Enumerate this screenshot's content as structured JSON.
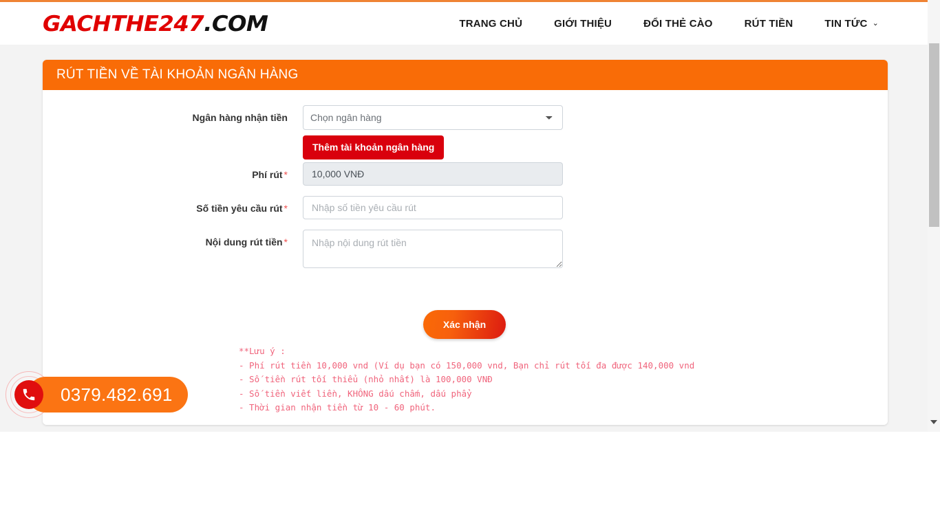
{
  "site": {
    "logo_red": "GACHTHE247",
    "logo_black": ".COM"
  },
  "nav": {
    "items": [
      {
        "label": "TRANG CHỦ",
        "has_chevron": false
      },
      {
        "label": "GIỚI THIỆU",
        "has_chevron": false
      },
      {
        "label": "ĐỔI THẺ CÀO",
        "has_chevron": false
      },
      {
        "label": "RÚT TIỀN",
        "has_chevron": false
      },
      {
        "label": "TIN TỨC",
        "has_chevron": true
      }
    ],
    "chevron_glyph": "⌄"
  },
  "card": {
    "title": "RÚT TIỀN VỀ TÀI KHOẢN NGÂN HÀNG",
    "header_color": "#f96c07"
  },
  "form": {
    "bank": {
      "label": "Ngân hàng nhận tiền",
      "required": false,
      "selected_option": "Chọn ngân hàng",
      "add_bank_button": "Thêm tài khoản ngân hàng",
      "add_bank_color": "#d9000d"
    },
    "fee": {
      "label": "Phí rút",
      "required": true,
      "value": "10,000 VNĐ"
    },
    "amount": {
      "label": "Số tiền yêu cầu rút",
      "required": true,
      "placeholder": "Nhập số tiền yêu cầu rút",
      "value": ""
    },
    "note_field": {
      "label": "Nội dung rút tiền",
      "required": true,
      "placeholder": "Nhập nội dung rút tiền",
      "value": ""
    },
    "required_marker": "*",
    "submit_label": "Xác nhận"
  },
  "notes": {
    "color": "#f0647c",
    "lines": [
      "**Lưu ý :",
      "- Phí rút tiền 10,000 vnd (Ví dụ bạn có 150,000 vnd, Bạn chỉ rút tối đa được 140,000 vnd",
      "- Số tiền rút tối thiểu (nhỏ nhất) là 100,000 VNĐ",
      "- Số tiền viết liền, KHÔNG dấu chấm, dấu phẩy",
      "- Thời gian nhận tiền từ 10 - 60 phút."
    ]
  },
  "phone_widget": {
    "number": "0379.482.691",
    "pill_color": "#fb7413",
    "icon_color": "#e00e0e"
  }
}
